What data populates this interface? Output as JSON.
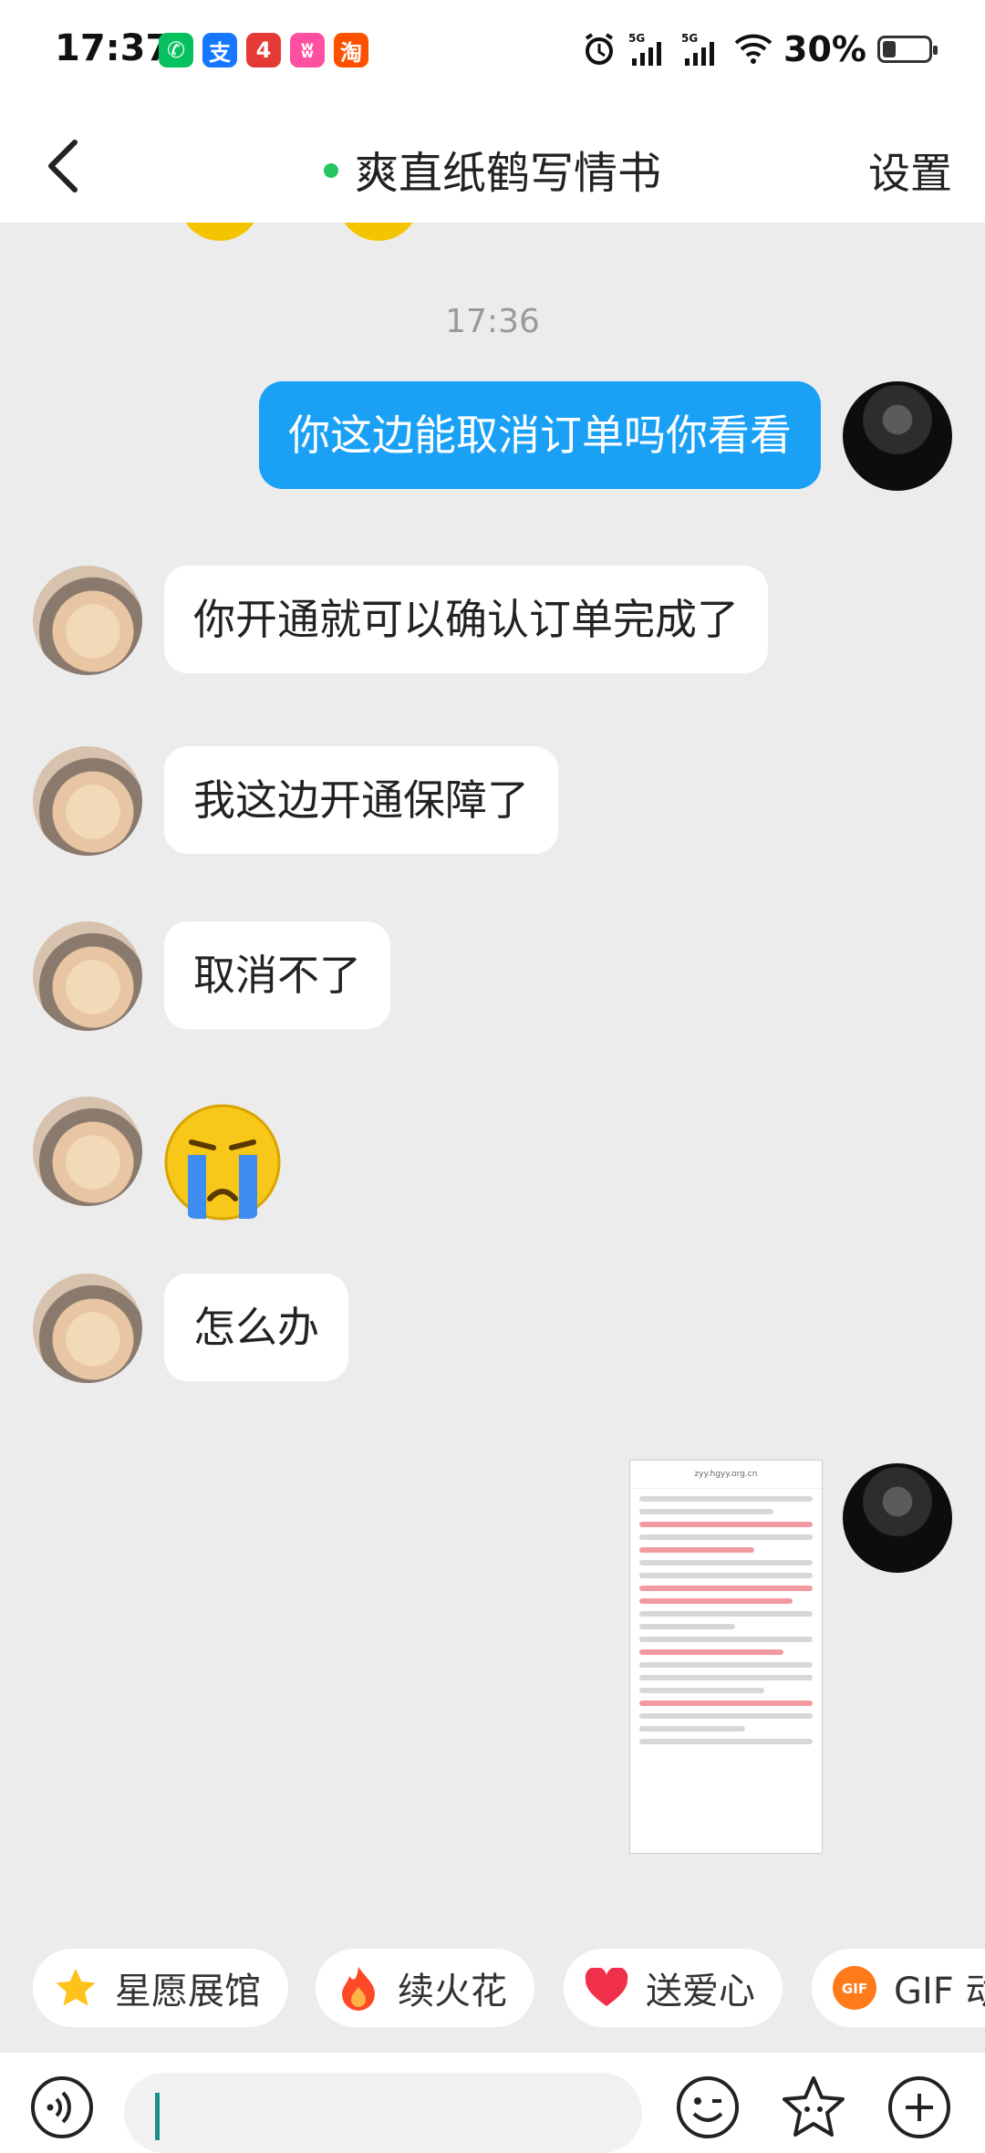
{
  "status_bar": {
    "time": "17:37",
    "apps": [
      {
        "icon": "wechat-icon",
        "glyph": "✆",
        "color": "#07c160"
      },
      {
        "icon": "alipay-icon",
        "glyph": "支",
        "color": "#1677ff"
      },
      {
        "icon": "app-red-icon",
        "glyph": "4",
        "color": "#e53935"
      },
      {
        "icon": "app-pink-icon",
        "glyph": "ʬ",
        "color": "#ff4fa1"
      },
      {
        "icon": "taobao-icon",
        "glyph": "淘",
        "color": "#ff5000"
      }
    ],
    "alarm_icon": "alarm-icon",
    "network": "5G",
    "battery": "30%",
    "battery_level": 0.3
  },
  "header": {
    "title": "爽直纸鹤写情书",
    "online": true,
    "settings_label": "设置",
    "online_color": "#22c55e"
  },
  "chat": {
    "timestamp": "17:36",
    "messages": [
      {
        "from": "me",
        "text": "你这边能取消订单吗你看看"
      },
      {
        "from": "her",
        "text": "你开通就可以确认订单完成了"
      },
      {
        "from": "her",
        "text": "我这边开通保障了"
      },
      {
        "from": "her",
        "text": "取消不了"
      },
      {
        "from": "her",
        "emoji": "crying-emoji"
      },
      {
        "from": "her",
        "text": "怎么办"
      },
      {
        "from": "me",
        "image": "screenshot-thumbnail"
      }
    ],
    "shared_screenshot": {
      "url_text": "zyy.hgyy.org.cn"
    }
  },
  "quick_chips": [
    {
      "label": "星愿展馆",
      "icon": "star-icon"
    },
    {
      "label": "续火花",
      "icon": "fire-icon"
    },
    {
      "label": "送爱心",
      "icon": "heart-icon"
    },
    {
      "label": "GIF 动",
      "icon": "gif-icon",
      "icon_text": "GIF"
    }
  ],
  "input_bar": {
    "voice_icon": "voice-icon",
    "emoji_icon": "emoji-icon",
    "sticker_icon": "sticker-icon",
    "plus_icon": "plus-icon",
    "input_value": ""
  },
  "colors": {
    "my_bubble": "#1aa1f5",
    "background": "#ececed"
  }
}
